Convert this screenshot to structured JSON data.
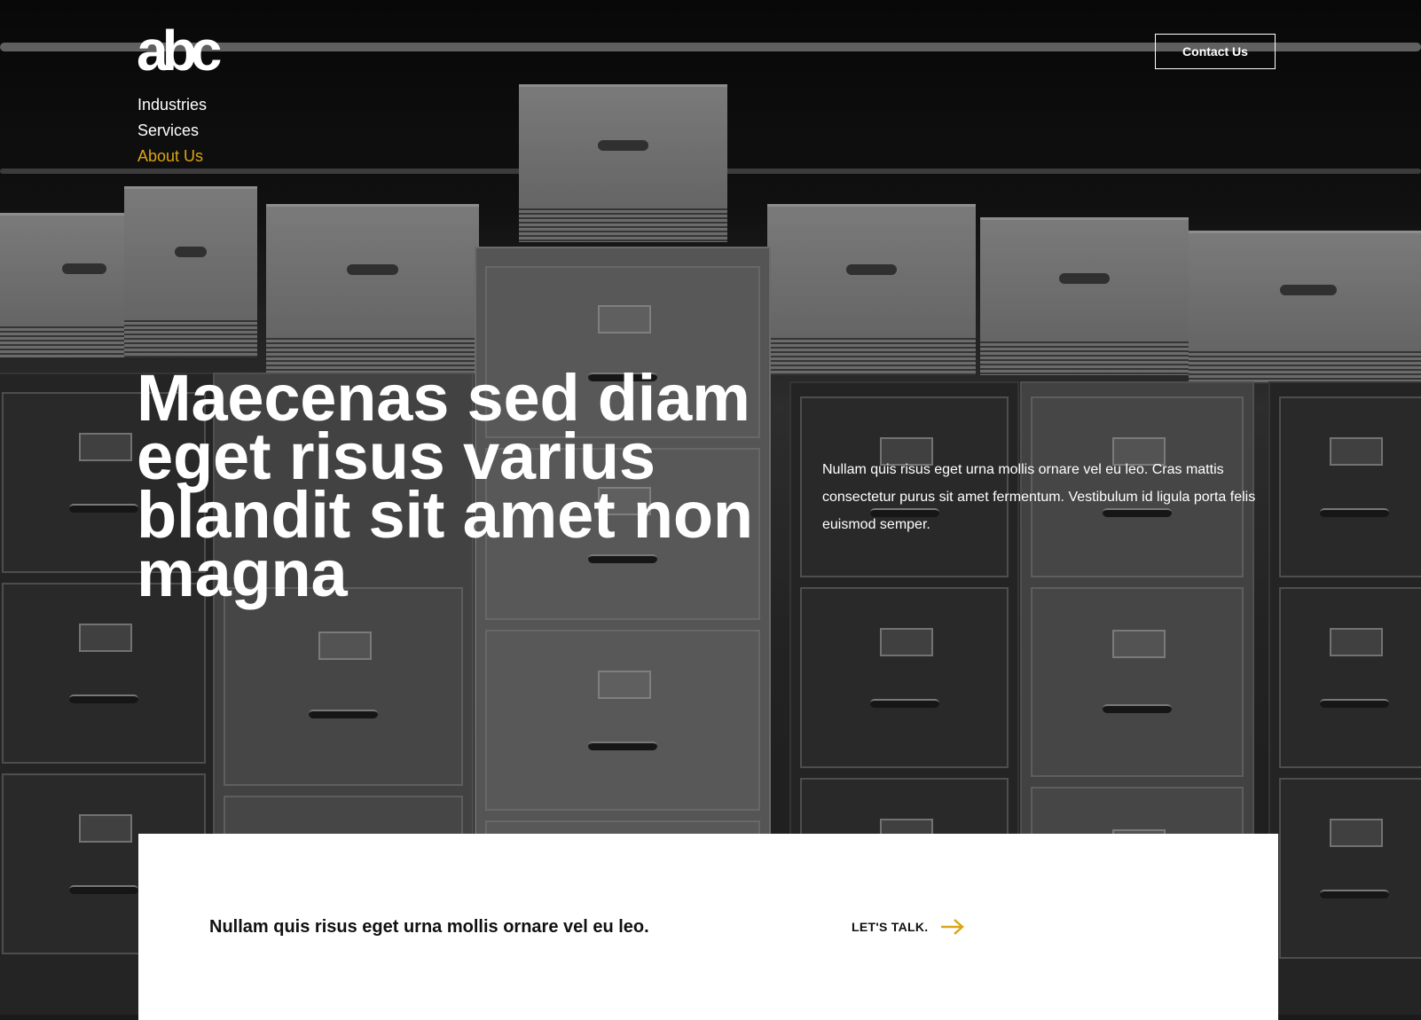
{
  "header": {
    "logo": "abc",
    "contact_label": "Contact Us"
  },
  "nav": {
    "items": [
      {
        "label": "Industries",
        "active": false
      },
      {
        "label": "Services",
        "active": false
      },
      {
        "label": "About Us",
        "active": true
      }
    ]
  },
  "hero": {
    "title": "Maecenas sed diam eget risus varius blandit sit amet non magna",
    "description": "Nullam quis risus eget urna mollis ornare vel eu leo. Cras mattis consectetur purus sit amet fermentum. Vestibulum id ligula porta felis euismod semper."
  },
  "cta": {
    "text": "Nullam quis risus eget urna mollis ornare vel eu leo.",
    "link_label": "LET'S TALK.",
    "icon": "arrow-right-icon"
  },
  "colors": {
    "accent": "#dba514",
    "text_light": "#ffffff",
    "card_bg": "#ffffff"
  }
}
